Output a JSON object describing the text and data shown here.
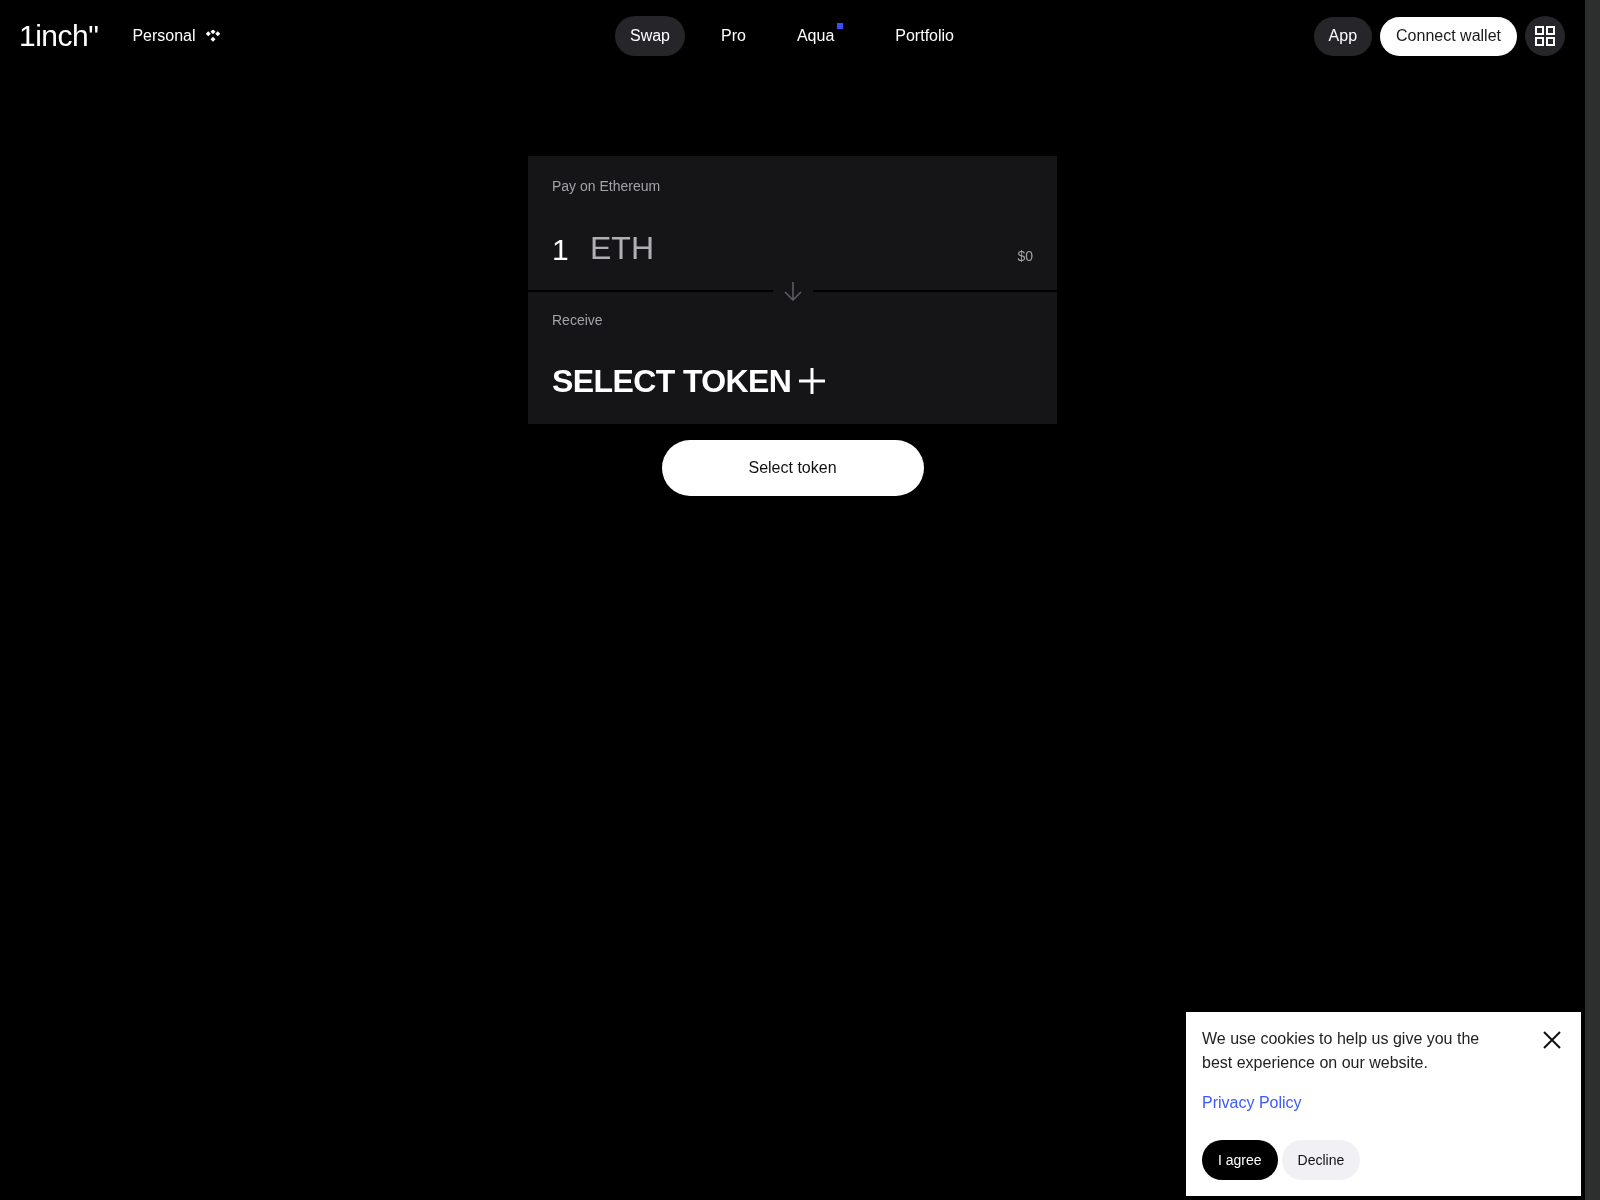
{
  "header": {
    "logo": "1inch\"",
    "account": {
      "label": "Personal"
    },
    "nav": [
      {
        "label": "Swap",
        "selected": true,
        "new": false
      },
      {
        "label": "Pro",
        "selected": false,
        "new": false
      },
      {
        "label": "Aqua",
        "selected": false,
        "new": true
      },
      {
        "label": "Portfolio",
        "selected": false,
        "new": false
      }
    ],
    "app_button": "App",
    "connect_button": "Connect wallet"
  },
  "swap": {
    "pay": {
      "label": "Pay on Ethereum",
      "amount": "1",
      "token": "ETH",
      "fiat_value": "$0"
    },
    "receive": {
      "label": "Receive",
      "token_prompt": "SELECT TOKEN"
    },
    "submit_button": "Select token"
  },
  "cookie_banner": {
    "message": "We use cookies to help us give you the best experience on our website.",
    "link": "Privacy Policy",
    "buttons": [
      {
        "label": "I agree",
        "kind": "primary"
      },
      {
        "label": "Decline",
        "kind": "secondary"
      }
    ]
  }
}
